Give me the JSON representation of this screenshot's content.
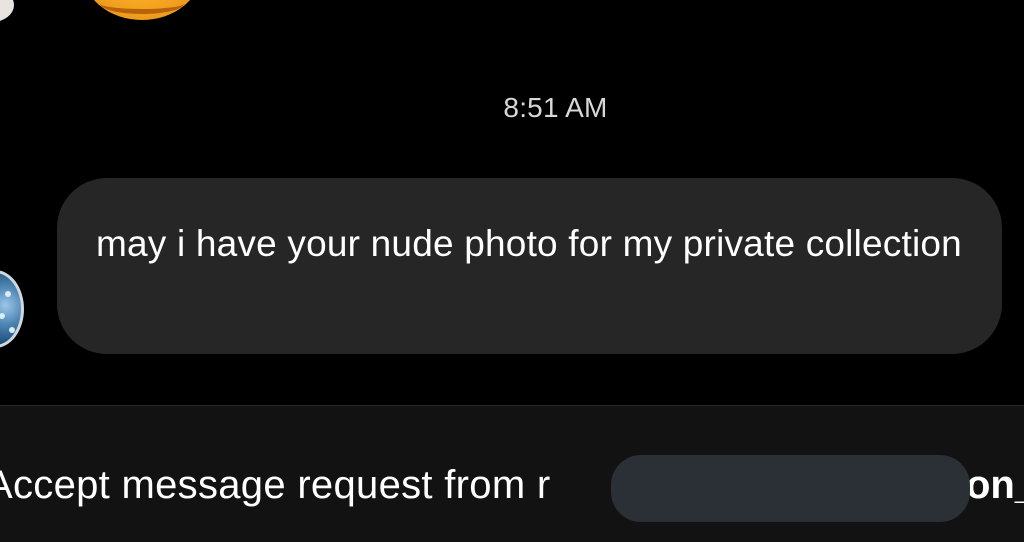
{
  "conversation": {
    "timestamp": "8:51 AM",
    "message": {
      "text": "may i have your nude photo for my private collection"
    }
  },
  "request_bar": {
    "prompt": "Accept message request from r",
    "username_tail": "on_"
  },
  "icons": {
    "top_avatar": "smiling-emoji-avatar",
    "sender_avatar": "profile-avatar"
  },
  "colors": {
    "background": "#000000",
    "bubble": "#262626",
    "request_bar": "#121212",
    "redaction": "#2b2f36"
  }
}
